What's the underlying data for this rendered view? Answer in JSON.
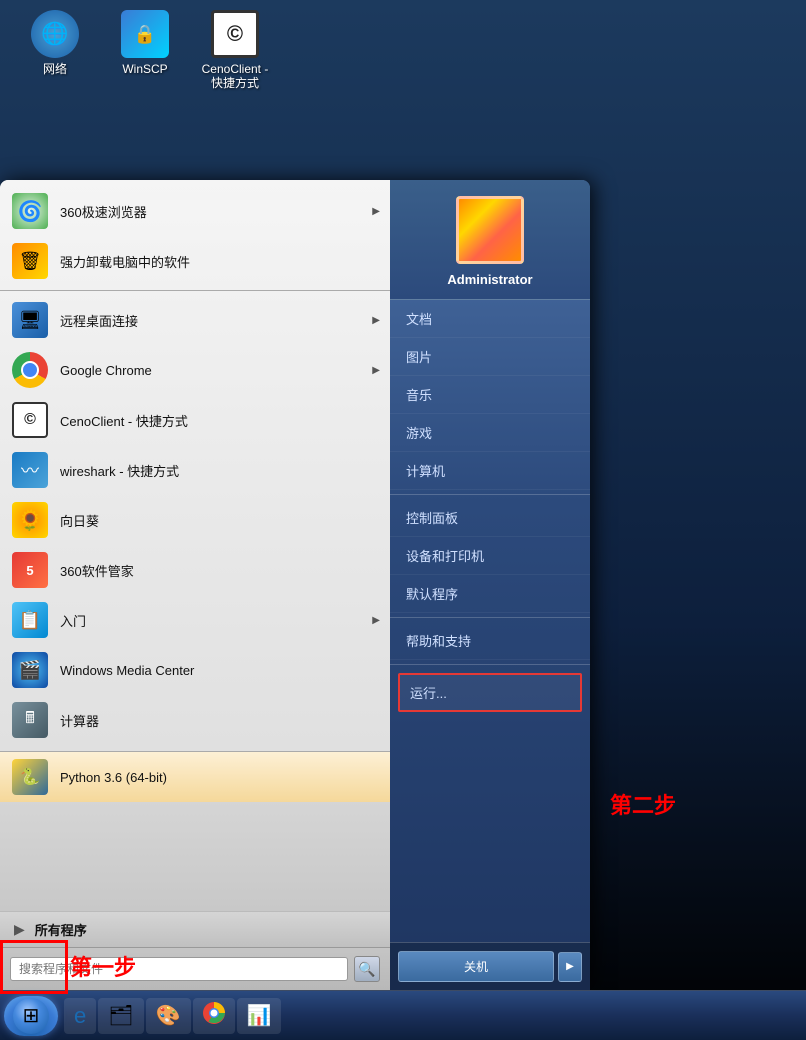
{
  "desktop": {
    "icons": [
      {
        "id": "network",
        "label": "网络",
        "icon": "🌐"
      },
      {
        "id": "winscp",
        "label": "WinSCP",
        "icon": "🔒"
      },
      {
        "id": "cenoclient",
        "label": "CenoClient -\n快捷方式",
        "icon": "©"
      }
    ]
  },
  "startMenu": {
    "leftTop": [
      {
        "id": "360browser",
        "label": "360极速浏览器",
        "hasArrow": true
      },
      {
        "id": "uninstall",
        "label": "强力卸载电脑中的软件",
        "hasArrow": false
      },
      {
        "id": "remote",
        "label": "远程桌面连接",
        "hasArrow": true
      },
      {
        "id": "chrome",
        "label": "Google Chrome",
        "hasArrow": true
      },
      {
        "id": "cenoclient",
        "label": "CenoClient - 快捷方式",
        "hasArrow": false
      },
      {
        "id": "wireshark",
        "label": "wireshark - 快捷方式",
        "hasArrow": false
      },
      {
        "id": "sunflower",
        "label": "向日葵",
        "hasArrow": false
      },
      {
        "id": "360mgr",
        "label": "360软件管家",
        "hasArrow": false
      },
      {
        "id": "intro",
        "label": "入门",
        "hasArrow": true
      },
      {
        "id": "wmc",
        "label": "Windows Media Center",
        "hasArrow": false
      },
      {
        "id": "calc",
        "label": "计算器",
        "hasArrow": false
      }
    ],
    "highlighted": {
      "id": "python",
      "label": "Python 3.6 (64-bit)"
    },
    "allPrograms": {
      "label": "所有程序"
    },
    "search": {
      "placeholder": "搜索程序和文件"
    },
    "right": {
      "username": "Administrator",
      "links": [
        "文档",
        "图片",
        "音乐",
        "游戏",
        "计算机",
        "控制面板",
        "设备和打印机",
        "默认程序",
        "帮助和支持"
      ],
      "run": "运行...",
      "shutdown": "关机"
    }
  },
  "annotations": {
    "step1": "第一步",
    "step2": "第二步"
  },
  "taskbar": {
    "items": [
      "🌐",
      "e",
      "🗂",
      "🎨",
      "🔵",
      "📊"
    ]
  }
}
